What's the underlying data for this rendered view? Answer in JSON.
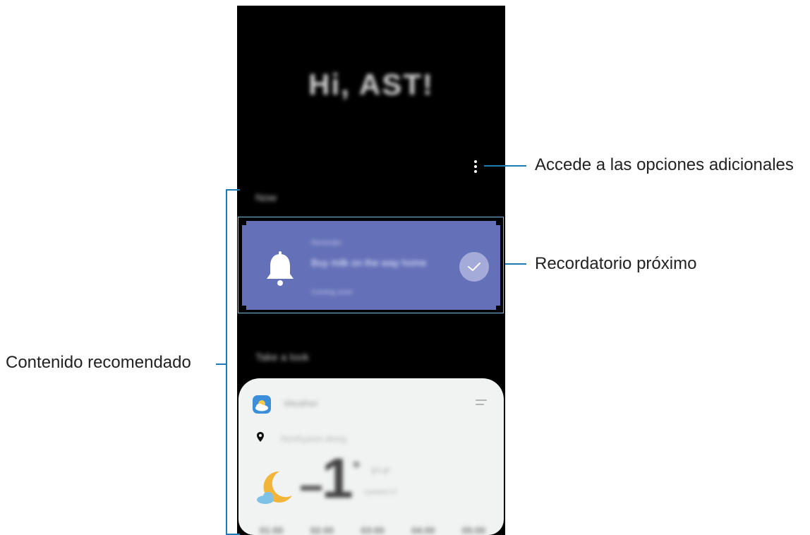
{
  "screen": {
    "greeting": "Hi, AST!",
    "section_now": "Now",
    "reminder": {
      "label": "Reminder",
      "title": "Buy milk on the way home",
      "time": "Coming soon"
    },
    "section_recommended": "Take a look",
    "weather_card": {
      "title": "Weather",
      "location": "Nonhyeon-dong",
      "temperature": "1",
      "degree_symbol": "°",
      "range": "3°/-3°",
      "updated": "Updated 07",
      "hours": [
        "01:00",
        "02:00",
        "03:00",
        "04:00",
        "05:00"
      ]
    }
  },
  "callouts": {
    "options": "Accede a las opciones adicionales",
    "reminder": "Recordatorio próximo",
    "recommended": "Contenido recomendado"
  },
  "colors": {
    "reminder_card": "#6470b8",
    "callout_line": "#1f7bb0",
    "highlight_border": "#77b9d9"
  },
  "icons": [
    "more-options-icon",
    "bell-icon",
    "check-icon",
    "weather-app-icon",
    "location-pin-icon",
    "moon-cloud-icon",
    "drag-handle-icon"
  ]
}
